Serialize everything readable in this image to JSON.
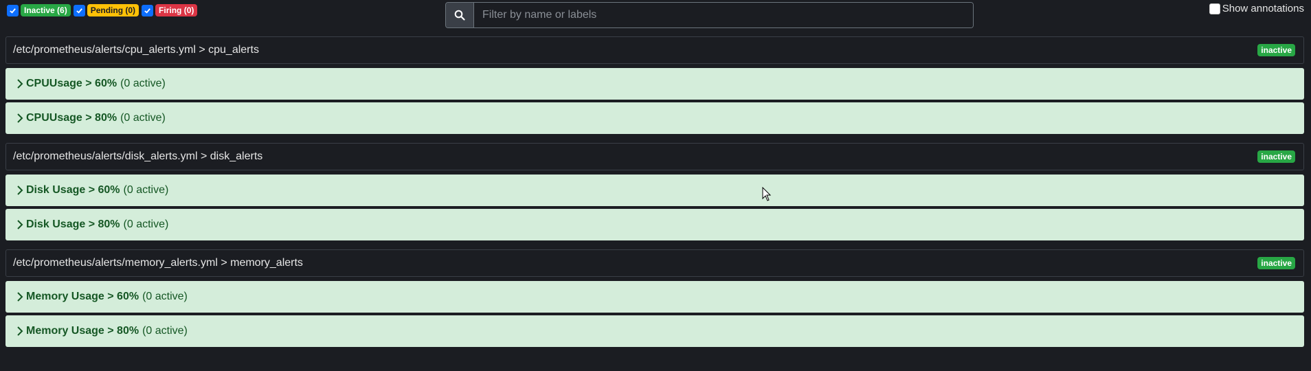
{
  "filters": [
    {
      "label": "Inactive (6)",
      "checked": true,
      "color": "#28a745"
    },
    {
      "label": "Pending (0)",
      "checked": true,
      "color": "#ffc107"
    },
    {
      "label": "Firing (0)",
      "checked": true,
      "color": "#dc3545"
    }
  ],
  "search": {
    "placeholder": "Filter by name or labels",
    "icon": "search-icon"
  },
  "annotations": {
    "label": "Show annotations",
    "checked": false
  },
  "groups": [
    {
      "header": "/etc/prometheus/alerts/cpu_alerts.yml > cpu_alerts",
      "status": "inactive",
      "rules": [
        {
          "name": "CPUUsage > 60%",
          "active": "(0 active)"
        },
        {
          "name": "CPUUsage > 80%",
          "active": "(0 active)"
        }
      ]
    },
    {
      "header": "/etc/prometheus/alerts/disk_alerts.yml > disk_alerts",
      "status": "inactive",
      "rules": [
        {
          "name": "Disk Usage > 60%",
          "active": "(0 active)"
        },
        {
          "name": "Disk Usage > 80%",
          "active": "(0 active)"
        }
      ]
    },
    {
      "header": "/etc/prometheus/alerts/memory_alerts.yml > memory_alerts",
      "status": "inactive",
      "rules": [
        {
          "name": "Memory Usage > 60%",
          "active": "(0 active)"
        },
        {
          "name": "Memory Usage > 80%",
          "active": "(0 active)"
        }
      ]
    }
  ],
  "colors": {
    "inactive": "#28a745",
    "pending": "#ffc107",
    "firing": "#dc3545",
    "rule_bg": "#d4edda",
    "rule_text": "#155724"
  }
}
